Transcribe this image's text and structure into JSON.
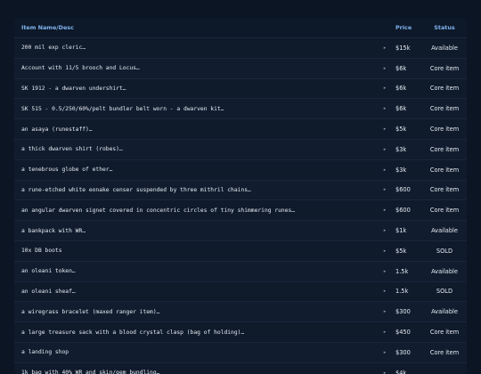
{
  "table": {
    "headers": {
      "name": "Item Name/Desc",
      "price": "Price",
      "status": "Status"
    },
    "expand_glyph": "▸",
    "rows": [
      {
        "name": "200 mil exp cleric…",
        "price": "$15k",
        "status": "Available"
      },
      {
        "name": "Account with 11/5 brooch and Locus…",
        "price": "$6k",
        "status": "Core item"
      },
      {
        "name": "SK 1912 - a dwarven undershirt…",
        "price": "$6k",
        "status": "Core item"
      },
      {
        "name": "SK 515 - 0.5/250/60%/pelt bundler belt worn - a dwarven kit…",
        "price": "$6k",
        "status": "Core item"
      },
      {
        "name": "an asaya (runestaff)…",
        "price": "$5k",
        "status": "Core item"
      },
      {
        "name": "a thick dwarven shirt (robes)…",
        "price": "$3k",
        "status": "Core item"
      },
      {
        "name": "a tenebrous globe of ether…",
        "price": "$3k",
        "status": "Core item"
      },
      {
        "name": "a rune-etched white eonake censer suspended by three mithril chains…",
        "price": "$600",
        "status": "Core item"
      },
      {
        "name": "an angular dwarven signet covered in concentric circles of tiny shimmering runes…",
        "price": "$600",
        "status": "Core item"
      },
      {
        "name": "a bankpack with WR…",
        "price": "$1k",
        "status": "Available"
      },
      {
        "name": "10x DB boots",
        "price": "$5k",
        "status": "SOLD"
      },
      {
        "name": "an oleani token…",
        "price": "1.5k",
        "status": "Available"
      },
      {
        "name": "an oleani sheaf…",
        "price": "1.5k",
        "status": "SOLD"
      },
      {
        "name": "a wiregrass bracelet (maxed ranger item)…",
        "price": "$300",
        "status": "Available"
      },
      {
        "name": "a large treasure sack with a blood crystal clasp (bag of holding)…",
        "price": "$450",
        "status": "Core item"
      },
      {
        "name": "a landing shop",
        "price": "$300",
        "status": "Core item"
      },
      {
        "name": "1k bag with 40% WR and skin/gem bundling…",
        "price": "$4k",
        "status": ""
      }
    ]
  }
}
